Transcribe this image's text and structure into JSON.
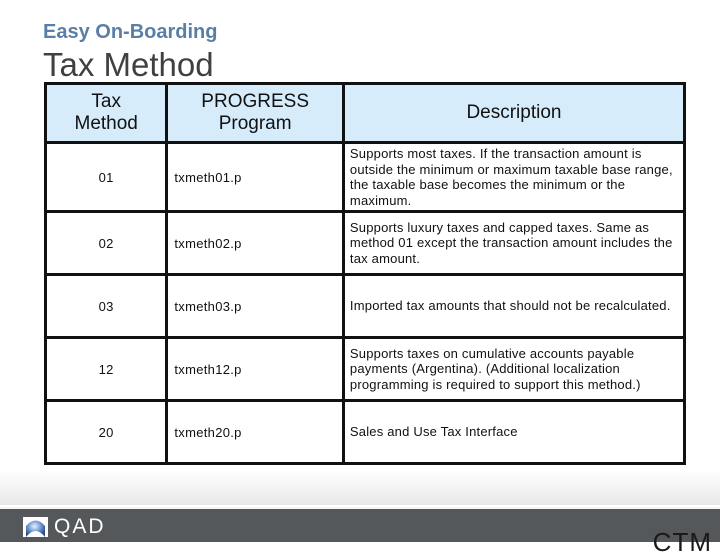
{
  "header": {
    "subtitle": "Easy On-Boarding",
    "title": "Tax Method"
  },
  "table": {
    "columns": [
      {
        "line1": "Tax",
        "line2": "Method"
      },
      {
        "line1": "PROGRESS",
        "line2": "Program"
      },
      {
        "line1": "Description",
        "line2": ""
      }
    ],
    "rows": [
      {
        "method": "01",
        "program": "txmeth01.p",
        "description": "Supports most taxes. If the transaction amount is outside the minimum or maximum taxable base range, the taxable base becomes the minimum or the maximum."
      },
      {
        "method": "02",
        "program": "txmeth02.p",
        "description": "Supports luxury taxes and capped taxes. Same as method 01 except the transaction amount includes the tax amount."
      },
      {
        "method": "03",
        "program": "txmeth03.p",
        "description": "Imported tax amounts that should not be recalculated."
      },
      {
        "method": "12",
        "program": "txmeth12.p",
        "description": "Supports taxes on cumulative accounts payable payments (Argentina). (Additional localization programming is required to support this method.)"
      },
      {
        "method": "20",
        "program": "txmeth20.p",
        "description": "Sales and Use Tax Interface"
      }
    ]
  },
  "footer": {
    "logo_text": "QAD",
    "logo_icon": "qad-logo-icon",
    "corner_text": "CTM"
  },
  "colors": {
    "subtitle": "#5a7fa6",
    "title": "#404040",
    "header_fill": "#d6ecfb",
    "footer_bar": "#55585b"
  }
}
